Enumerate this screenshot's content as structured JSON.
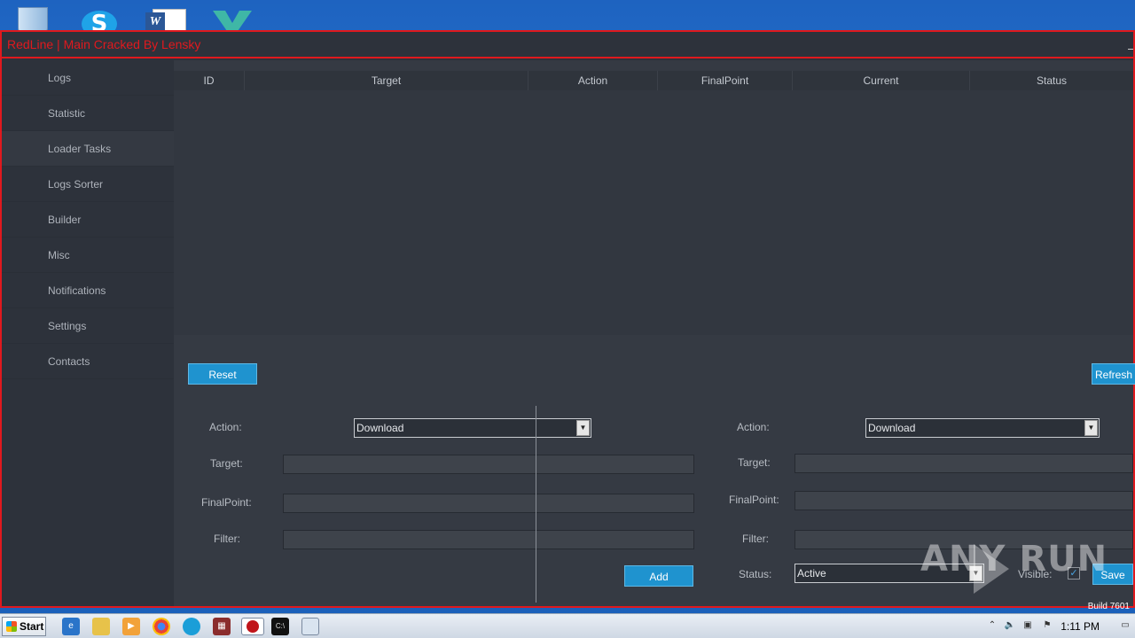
{
  "window": {
    "title": "RedLine | Main Cracked By Lensky"
  },
  "sidebar": {
    "items": [
      {
        "label": "Logs"
      },
      {
        "label": "Statistic"
      },
      {
        "label": "Loader Tasks",
        "active": true
      },
      {
        "label": "Logs Sorter"
      },
      {
        "label": "Builder"
      },
      {
        "label": "Misc"
      },
      {
        "label": "Notifications"
      },
      {
        "label": "Settings"
      },
      {
        "label": "Contacts"
      }
    ]
  },
  "table": {
    "columns": [
      "ID",
      "Target",
      "Action",
      "FinalPoint",
      "Current",
      "Status"
    ],
    "rows": []
  },
  "buttons": {
    "reset": "Reset",
    "refresh": "Refresh",
    "add": "Add",
    "save": "Save"
  },
  "left_form": {
    "action_label": "Action:",
    "action_value": "Download",
    "target_label": "Target:",
    "target_value": "",
    "finalpoint_label": "FinalPoint:",
    "finalpoint_value": "",
    "filter_label": "Filter:",
    "filter_value": ""
  },
  "right_form": {
    "action_label": "Action:",
    "action_value": "Download",
    "target_label": "Target:",
    "target_value": "",
    "finalpoint_label": "FinalPoint:",
    "finalpoint_value": "",
    "filter_label": "Filter:",
    "filter_value": "",
    "status_label": "Status:",
    "status_value": "Active",
    "visible_label": "Visible:",
    "visible_checked": true
  },
  "watermark": {
    "text": "ANY RUN"
  },
  "build_text": "Build 7601",
  "taskbar": {
    "start_label": "Start",
    "clock": "1:11 PM"
  },
  "colors": {
    "accent_red": "#e0191e",
    "button_blue": "#1f93cf",
    "panel_bg": "#2d323b"
  }
}
